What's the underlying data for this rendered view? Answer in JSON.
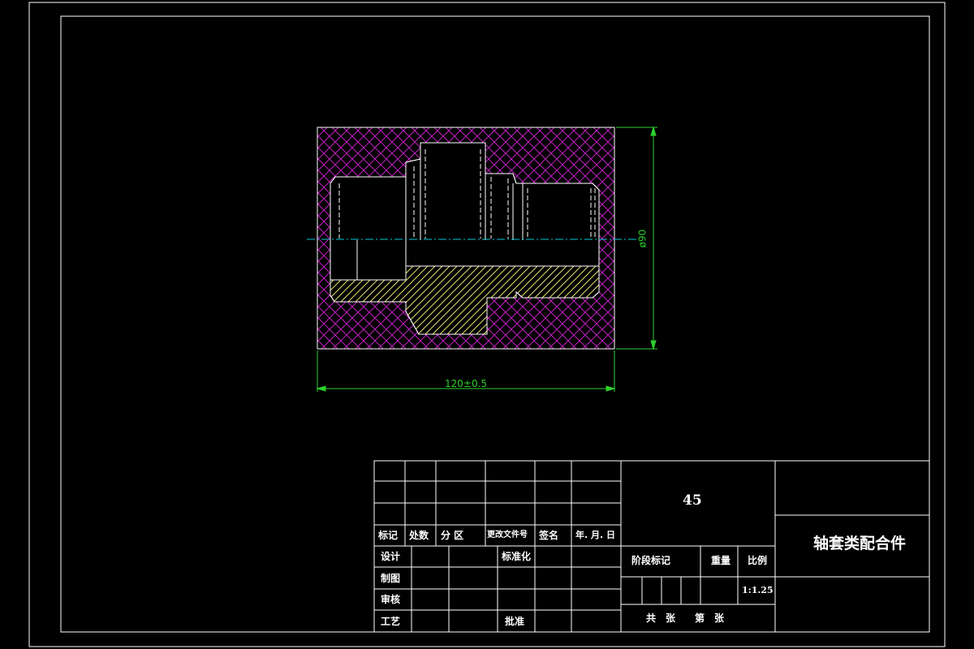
{
  "dimensions": {
    "width": "120±0.5",
    "diameter": "ø90"
  },
  "title_block": {
    "material": "45",
    "part_name": "轴套类配合件",
    "revision_headers": [
      "标记",
      "处数",
      "分 区",
      "更改文件号",
      "签名",
      "年. 月. 日"
    ],
    "design": "设计",
    "standardization": "标准化",
    "drawing": "制图",
    "review": "审核",
    "process": "工艺",
    "approval": "批准",
    "stage_mark": "阶段标记",
    "weight": "重量",
    "scale_label": "比例",
    "scale_value": "1:1.25",
    "sheets_text": "共　张　　第　张"
  },
  "colors": {
    "background": "#000000",
    "line": "#ffffff",
    "dimension": "#2cd12c",
    "centerline": "#00c8d8",
    "crosshatch": "#c21fc2",
    "part_hatch": "#e3e36a"
  }
}
